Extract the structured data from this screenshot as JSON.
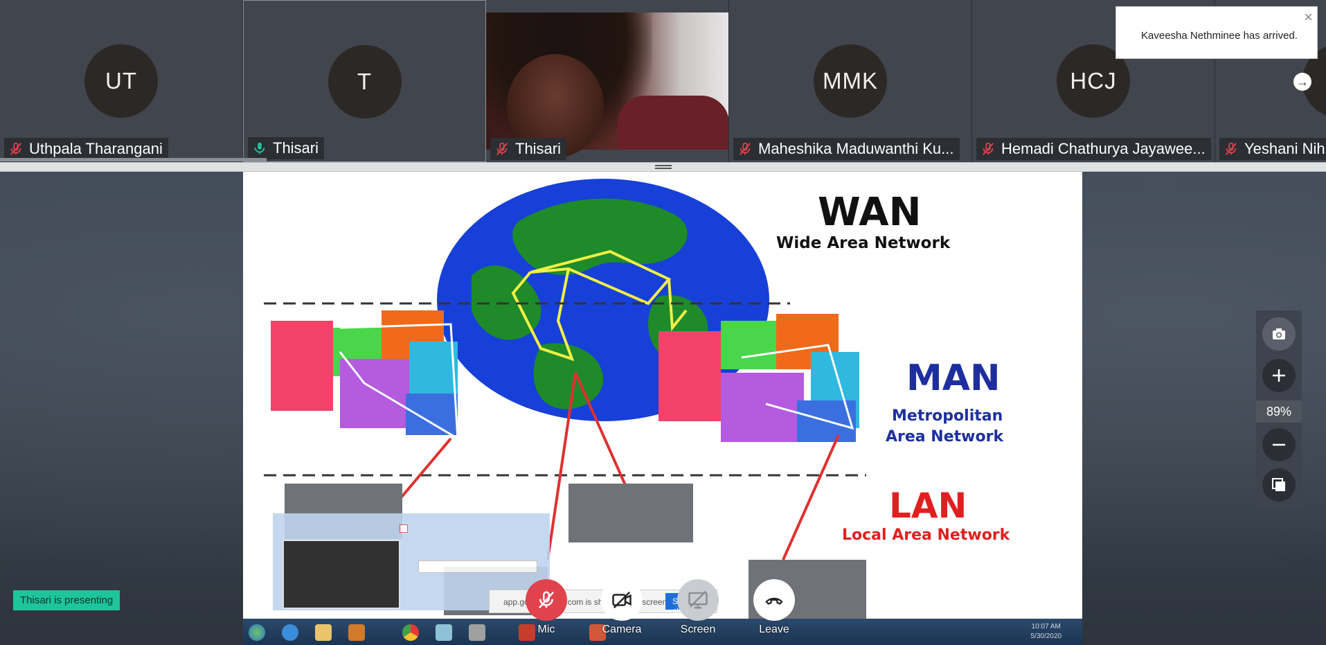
{
  "participants": [
    {
      "initials": "UT",
      "name": "Uthpala Tharangani",
      "mic": "muted"
    },
    {
      "initials": "T",
      "name": "Thisari",
      "mic": "active"
    },
    {
      "initials": "",
      "name": "Thisari",
      "mic": "muted",
      "video": true
    },
    {
      "initials": "MMK",
      "name": "Maheshika Maduwanthi Ku...",
      "mic": "muted"
    },
    {
      "initials": "HCJ",
      "name": "Hemadi Chathurya Jayawee...",
      "mic": "muted"
    },
    {
      "initials": "",
      "name": "Yeshani Nih",
      "mic": "muted"
    }
  ],
  "toast": {
    "text": "Kaveesha Nethminee has arrived.",
    "close": "×"
  },
  "slide": {
    "wan_title": "WAN",
    "wan_subtitle": "Wide Area Network",
    "man_title": "MAN",
    "man_subtitle_1": "Metropolitan",
    "man_subtitle_2": "Area Network",
    "lan_title": "LAN",
    "lan_subtitle": "Local Area Network",
    "taskbar_time": "10:07 AM",
    "taskbar_date": "5/30/2020",
    "share_text": "app.gotomeeting.com is sharing your screen.",
    "share_stop": "Stop sharing"
  },
  "presenting_badge": "Thisari is presenting",
  "controls": {
    "mic": "Mic",
    "camera": "Camera",
    "screen": "Screen",
    "leave": "Leave"
  },
  "zoom": {
    "level": "89%"
  },
  "colors": {
    "accent_green": "#1ec59b",
    "mic_muted_red": "#e0434d",
    "mic_active_green": "#1ec59b",
    "toolbar_mic_red": "#e0434d"
  }
}
